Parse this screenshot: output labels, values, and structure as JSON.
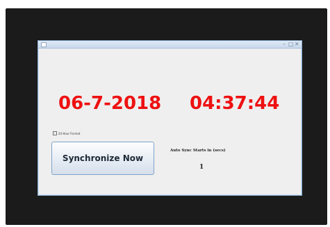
{
  "window": {
    "title": "",
    "controls": {
      "minimize": "–",
      "maximize": "□",
      "close": "✕"
    }
  },
  "clock": {
    "date": "06-7-2018",
    "time": "04:37:44",
    "color": "#ee1111"
  },
  "options": {
    "format_24h_label": "24 Hour Format",
    "format_24h_checked": true
  },
  "actions": {
    "sync_now_label": "Synchronize Now"
  },
  "auto_sync": {
    "label": "Auto Sync Starts in (secs)",
    "countdown": "1"
  }
}
